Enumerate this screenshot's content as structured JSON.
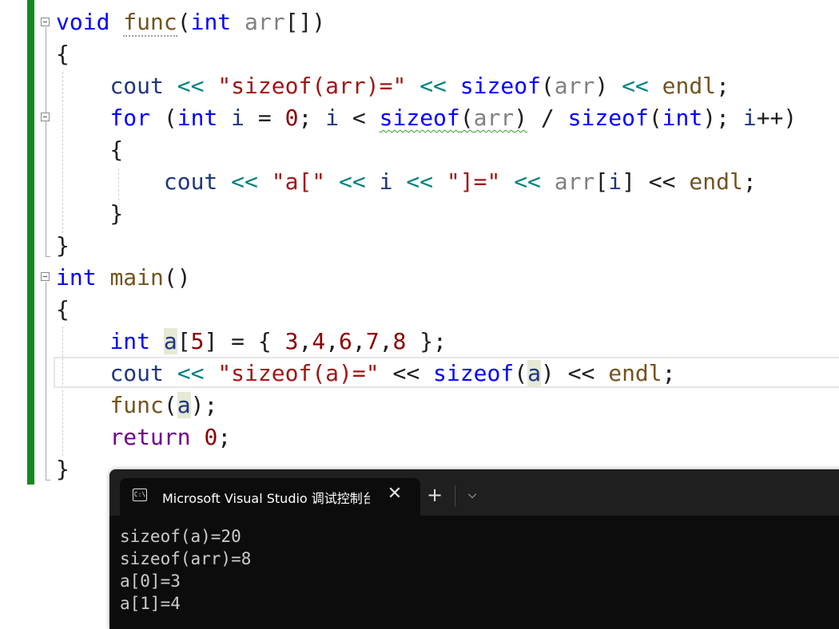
{
  "editor": {
    "lines": [
      [
        [
          "ty",
          "void"
        ],
        [
          "pl",
          " "
        ],
        [
          "fn_dotted",
          "func"
        ],
        [
          "pl",
          "("
        ],
        [
          "ty",
          "int"
        ],
        [
          "pl",
          " "
        ],
        [
          "prm",
          "arr"
        ],
        [
          "pl",
          "[])"
        ]
      ],
      [
        [
          "pl",
          "{"
        ]
      ],
      [
        [
          "pl",
          "    "
        ],
        [
          "var",
          "cout"
        ],
        [
          "pl",
          " "
        ],
        [
          "op",
          "<<"
        ],
        [
          "pl",
          " "
        ],
        [
          "str",
          "\"sizeof(arr)=\""
        ],
        [
          "pl",
          " "
        ],
        [
          "op",
          "<<"
        ],
        [
          "pl",
          " "
        ],
        [
          "kw",
          "sizeof"
        ],
        [
          "pl",
          "("
        ],
        [
          "prm",
          "arr"
        ],
        [
          "pl",
          ") "
        ],
        [
          "op",
          "<<"
        ],
        [
          "pl",
          " "
        ],
        [
          "fn",
          "endl"
        ],
        [
          "pl",
          ";"
        ]
      ],
      [
        [
          "pl",
          "    "
        ],
        [
          "kw",
          "for"
        ],
        [
          "pl",
          " ("
        ],
        [
          "ty",
          "int"
        ],
        [
          "pl",
          " "
        ],
        [
          "var",
          "i"
        ],
        [
          "pl",
          " = "
        ],
        [
          "num",
          "0"
        ],
        [
          "pl",
          "; "
        ],
        [
          "var",
          "i"
        ],
        [
          "pl",
          " < "
        ],
        [
          "sq_kw",
          "sizeof"
        ],
        [
          "sq_pl",
          "("
        ],
        [
          "sq_prm",
          "arr"
        ],
        [
          "sq_pl",
          ")"
        ],
        [
          "pl",
          " / "
        ],
        [
          "kw",
          "sizeof"
        ],
        [
          "pl",
          "("
        ],
        [
          "ty",
          "int"
        ],
        [
          "pl",
          "); "
        ],
        [
          "var",
          "i"
        ],
        [
          "pl",
          "++)"
        ]
      ],
      [
        [
          "pl",
          "    {"
        ]
      ],
      [
        [
          "pl",
          "        "
        ],
        [
          "var",
          "cout"
        ],
        [
          "pl",
          " "
        ],
        [
          "op",
          "<<"
        ],
        [
          "pl",
          " "
        ],
        [
          "str",
          "\"a[\""
        ],
        [
          "pl",
          " "
        ],
        [
          "op",
          "<<"
        ],
        [
          "pl",
          " "
        ],
        [
          "var",
          "i"
        ],
        [
          "pl",
          " "
        ],
        [
          "op",
          "<<"
        ],
        [
          "pl",
          " "
        ],
        [
          "str",
          "\"]=\""
        ],
        [
          "pl",
          " "
        ],
        [
          "op",
          "<<"
        ],
        [
          "pl",
          " "
        ],
        [
          "prm",
          "arr"
        ],
        [
          "pl",
          "["
        ],
        [
          "var",
          "i"
        ],
        [
          "pl",
          "] << "
        ],
        [
          "fn",
          "endl"
        ],
        [
          "pl",
          ";"
        ]
      ],
      [
        [
          "pl",
          "    }"
        ]
      ],
      [
        [
          "pl",
          "}"
        ]
      ],
      [
        [
          "ty",
          "int"
        ],
        [
          "pl",
          " "
        ],
        [
          "fn",
          "main"
        ],
        [
          "pl",
          "()"
        ]
      ],
      [
        [
          "pl",
          "{"
        ]
      ],
      [
        [
          "pl",
          "    "
        ],
        [
          "ty",
          "int"
        ],
        [
          "pl",
          " "
        ],
        [
          "var_hl",
          "a"
        ],
        [
          "pl",
          "["
        ],
        [
          "num",
          "5"
        ],
        [
          "pl",
          "] = { "
        ],
        [
          "num",
          "3"
        ],
        [
          "pl",
          ","
        ],
        [
          "num",
          "4"
        ],
        [
          "pl",
          ","
        ],
        [
          "num",
          "6"
        ],
        [
          "pl",
          ","
        ],
        [
          "num",
          "7"
        ],
        [
          "pl",
          ","
        ],
        [
          "num",
          "8"
        ],
        [
          "pl",
          " };"
        ]
      ],
      [
        [
          "pl",
          "    "
        ],
        [
          "var",
          "cout"
        ],
        [
          "pl",
          " "
        ],
        [
          "op",
          "<<"
        ],
        [
          "pl",
          " "
        ],
        [
          "str",
          "\"sizeof(a)=\""
        ],
        [
          "pl",
          " << "
        ],
        [
          "kw",
          "sizeof"
        ],
        [
          "pl",
          "("
        ],
        [
          "var_hl",
          "a"
        ],
        [
          "pl",
          ") << "
        ],
        [
          "fn",
          "endl"
        ],
        [
          "pl",
          ";"
        ]
      ],
      [
        [
          "pl",
          "    "
        ],
        [
          "fn",
          "func"
        ],
        [
          "pl",
          "("
        ],
        [
          "var_hl",
          "a"
        ],
        [
          "pl",
          ");"
        ]
      ],
      [
        [
          "pl",
          "    "
        ],
        [
          "mac",
          "return"
        ],
        [
          "pl",
          " "
        ],
        [
          "num",
          "0"
        ],
        [
          "pl",
          ";"
        ]
      ],
      [
        [
          "pl",
          "}"
        ]
      ]
    ]
  },
  "terminal": {
    "tab_title": "Microsoft Visual Studio 调试控制台",
    "icon_text": "C:\\",
    "close_glyph": "✕",
    "new_tab_glyph": "+",
    "dropdown_glyph": "⌵",
    "output": [
      "sizeof(a)=20",
      "sizeof(arr)=8",
      "a[0]=3",
      "a[1]=4"
    ]
  }
}
